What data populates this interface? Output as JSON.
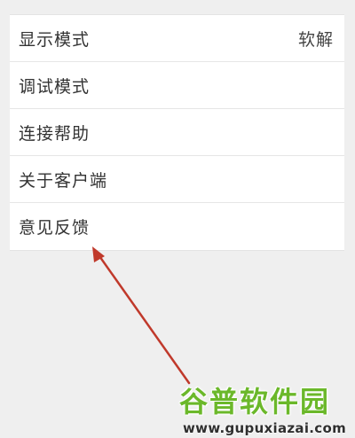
{
  "menu": {
    "items": [
      {
        "label": "显示模式",
        "value": "软解"
      },
      {
        "label": "调试模式",
        "value": ""
      },
      {
        "label": "连接帮助",
        "value": ""
      },
      {
        "label": "关于客户端",
        "value": ""
      },
      {
        "label": "意见反馈",
        "value": ""
      }
    ]
  },
  "annotation": {
    "arrow_color": "#c0392b"
  },
  "watermark": {
    "brand": "谷普软件园",
    "url": "www.gupuxiazai.com",
    "brand_color": "#6bb82a"
  }
}
